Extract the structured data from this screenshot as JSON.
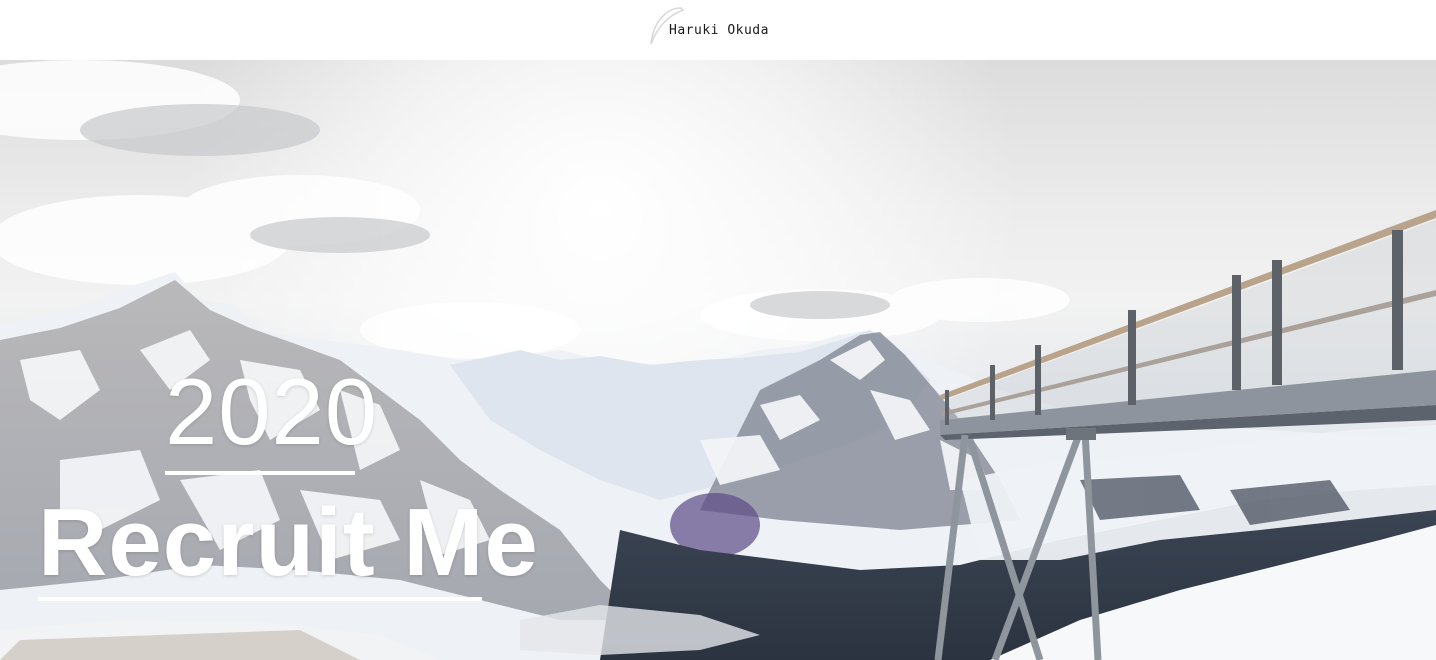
{
  "header": {
    "logo_text": "Haruki Okuda",
    "logo_icon": "crescent-swoosh-icon"
  },
  "hero": {
    "year": "2020",
    "headline": "Recruit Me",
    "background_image": "snowy-mountains-with-skywalk-image"
  },
  "colors": {
    "header_bg": "#ffffff",
    "headline_text": "#ffffff",
    "logo_text": "#1a1a1a"
  }
}
